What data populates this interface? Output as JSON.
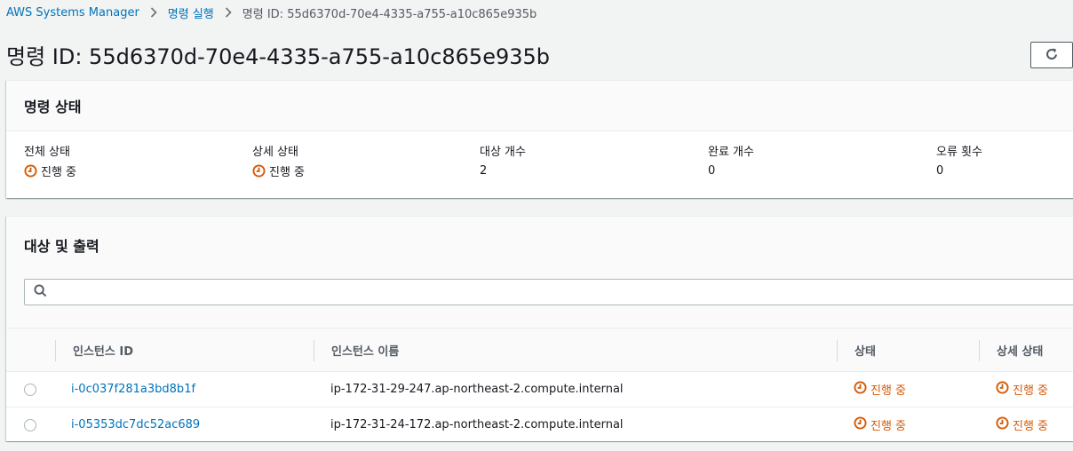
{
  "breadcrumb": {
    "items": [
      "AWS Systems Manager",
      "명령 실행"
    ],
    "current": "명령 ID: 55d6370d-70e4-4335-a755-a10c865e935b"
  },
  "page": {
    "title": "명령 ID: 55d6370d-70e4-4335-a755-a10c865e935b"
  },
  "status_panel": {
    "title": "명령 상태",
    "stats": [
      {
        "label": "전체 상태",
        "value": "진행 중"
      },
      {
        "label": "상세 상태",
        "value": "진행 중"
      },
      {
        "label": "대상 개수",
        "value": "2"
      },
      {
        "label": "완료 개수",
        "value": "0"
      },
      {
        "label": "오류 횟수",
        "value": "0"
      }
    ]
  },
  "targets_panel": {
    "title": "대상 및 출력",
    "search_value": "",
    "columns": [
      "인스턴스 ID",
      "인스턴스 이름",
      "상태",
      "상세 상태"
    ],
    "rows": [
      {
        "instance_id": "i-0c037f281a3bd8b1f",
        "instance_name": "ip-172-31-29-247.ap-northeast-2.compute.internal",
        "status": "진행 중",
        "detail_status": "진행 중"
      },
      {
        "instance_id": "i-05353dc7dc52ac689",
        "instance_name": "ip-172-31-24-172.ap-northeast-2.compute.internal",
        "status": "진행 중",
        "detail_status": "진행 중"
      }
    ]
  },
  "colors": {
    "link": "#0073bb",
    "in_progress": "#d45b07",
    "text": "#16191f"
  },
  "icons": {
    "refresh": "refresh-icon",
    "search": "search-icon",
    "status": "clock-icon",
    "separator": "chevron-right-icon"
  }
}
